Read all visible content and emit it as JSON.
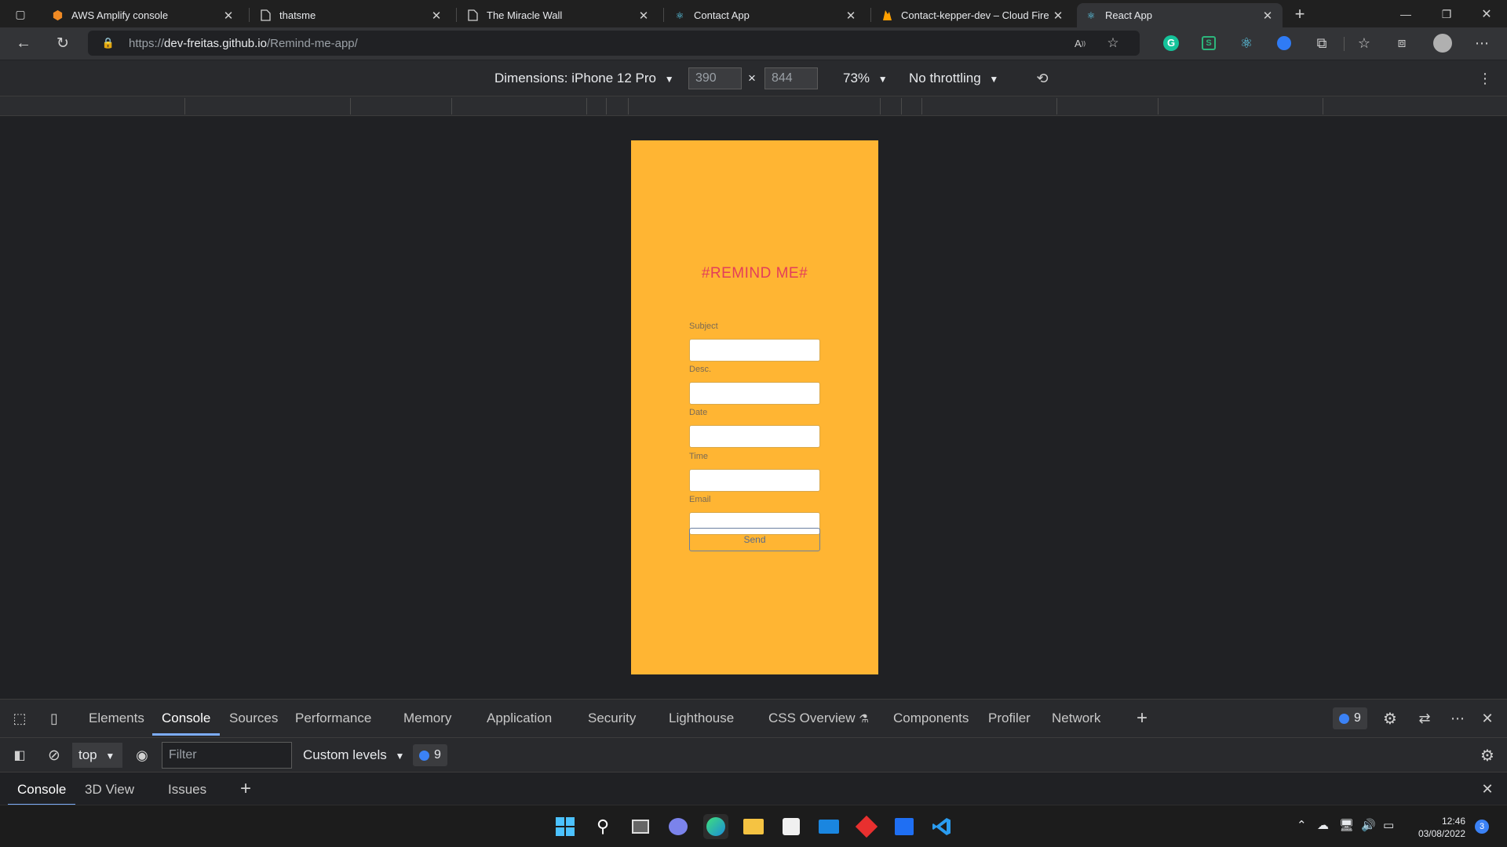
{
  "browser": {
    "tabs": [
      {
        "title": "AWS Amplify console",
        "icon": "aws-icon",
        "active": false
      },
      {
        "title": "thatsme",
        "icon": "page-icon",
        "active": false
      },
      {
        "title": "The Miracle Wall",
        "icon": "page-icon",
        "active": false
      },
      {
        "title": "Contact App",
        "icon": "react-icon",
        "active": false
      },
      {
        "title": "Contact-kepper-dev – Cloud Fire",
        "icon": "firebase-icon",
        "active": false
      },
      {
        "title": "React App",
        "icon": "react-icon",
        "active": true
      }
    ],
    "url_prefix": "https://",
    "url_host": "dev-freitas.github.io",
    "url_path": "/Remind-me-app/"
  },
  "device_toolbar": {
    "dimensions_label": "Dimensions: iPhone 12 Pro",
    "width": "390",
    "height": "844",
    "times": "×",
    "zoom": "73%",
    "throttling": "No throttling"
  },
  "app": {
    "title": "#REMIND ME#",
    "background": "#ffb533",
    "title_color": "#e33e5a",
    "fields": [
      {
        "label": "Subject",
        "value": ""
      },
      {
        "label": "Desc.",
        "value": ""
      },
      {
        "label": "Date",
        "value": ""
      },
      {
        "label": "Time",
        "value": ""
      },
      {
        "label": "Email",
        "value": ""
      }
    ],
    "send_label": "Send"
  },
  "devtools": {
    "tabs": [
      "Elements",
      "Console",
      "Sources",
      "Performance",
      "Memory",
      "Application",
      "Security",
      "Lighthouse",
      "CSS Overview",
      "Components",
      "Profiler",
      "Network"
    ],
    "active_tab": "Console",
    "issues_count": "9",
    "context": "top",
    "filter_placeholder": "Filter",
    "levels": "Custom levels",
    "console_count": "9",
    "drawer_tabs": [
      "Console",
      "3D View",
      "Issues"
    ]
  },
  "taskbar": {
    "time": "12:46",
    "date": "03/08/2022",
    "notification_count": "3"
  }
}
